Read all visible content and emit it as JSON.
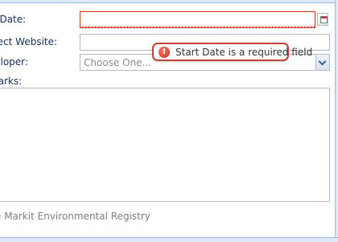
{
  "form": {
    "start_date_label": "rt Date:",
    "website_label": "oject Website:",
    "developer_label": "veloper:",
    "developer_placeholder": "Choose One...",
    "remarks_label": "marks:"
  },
  "tooltip": {
    "message": "Start Date is a required field",
    "icon": "error-icon"
  },
  "footer": {
    "text": "e Markit Environmental Registry"
  },
  "colors": {
    "error_border": "#c5423c",
    "label_text": "#15305a",
    "field_border": "#b5b8c8"
  }
}
